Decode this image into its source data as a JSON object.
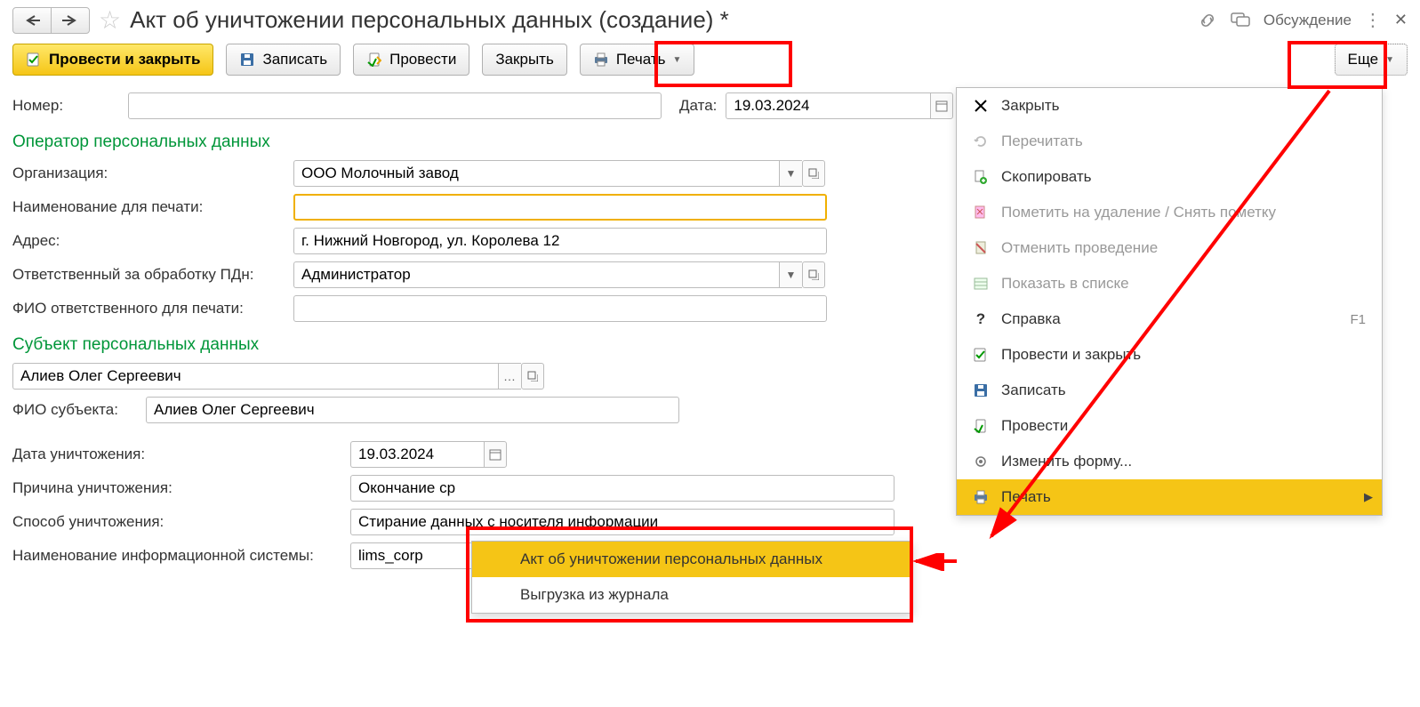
{
  "header": {
    "title": "Акт об уничтожении персональных данных (создание) *",
    "discuss": "Обсуждение"
  },
  "toolbar": {
    "post_close": "Провести и закрыть",
    "save": "Записать",
    "post": "Провести",
    "close": "Закрыть",
    "print": "Печать",
    "more": "Еще"
  },
  "fields": {
    "number_label": "Номер:",
    "number_value": "",
    "date_label": "Дата:",
    "date_value": "19.03.2024"
  },
  "section_operator": "Оператор персональных данных",
  "operator": {
    "org_label": "Организация:",
    "org_value": "ООО Молочный завод",
    "printname_label": "Наименование для печати:",
    "printname_value": "",
    "address_label": "Адрес:",
    "address_value": "г. Нижний Новгород, ул. Королева 12",
    "resp_label": "Ответственный за обработку ПДн:",
    "resp_value": "Администратор",
    "respfio_label": "ФИО ответственного для печати:",
    "respfio_value": ""
  },
  "section_subject": "Субъект персональных данных",
  "subject": {
    "subject_value": "Алиев Олег Сергеевич",
    "fio_label": "ФИО субъекта:",
    "fio_value": "Алиев Олег Сергеевич",
    "destroy_date_label": "Дата уничтожения:",
    "destroy_date_value": "19.03.2024",
    "reason_label": "Причина уничтожения:",
    "reason_value": "Окончание ср",
    "method_label": "Способ уничтожения:",
    "method_value": "Стирание данных с носителя информации",
    "system_label": "Наименование информационной системы:",
    "system_value": "lims_corp"
  },
  "menu": {
    "close": "Закрыть",
    "reread": "Перечитать",
    "copy": "Скопировать",
    "markdel": "Пометить на удаление / Снять пометку",
    "unpost": "Отменить проведение",
    "showlist": "Показать в списке",
    "help": "Справка",
    "help_key": "F1",
    "post_close": "Провести и закрыть",
    "save": "Записать",
    "post": "Провести",
    "editform": "Изменить форму...",
    "print": "Печать"
  },
  "submenu": {
    "act": "Акт об уничтожении персональных данных",
    "export": "Выгрузка из журнала"
  }
}
